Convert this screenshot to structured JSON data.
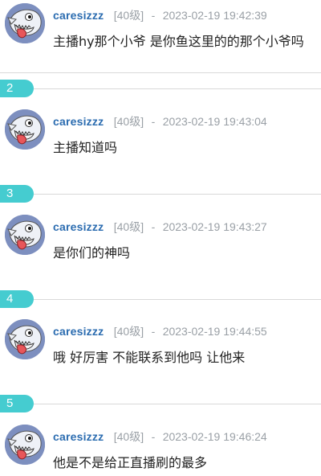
{
  "comments": [
    {
      "username": "caresizzz",
      "level": "[40级]",
      "separator": "-",
      "timestamp": "2023-02-19 19:42:39",
      "text": "主播hy那个小爷 是你鱼这里的的那个小爷吗"
    },
    {
      "floor": "2",
      "username": "caresizzz",
      "level": "[40级]",
      "separator": "-",
      "timestamp": "2023-02-19 19:43:04",
      "text": "主播知道吗"
    },
    {
      "floor": "3",
      "username": "caresizzz",
      "level": "[40级]",
      "separator": "-",
      "timestamp": "2023-02-19 19:43:27",
      "text": "是你们的神吗"
    },
    {
      "floor": "4",
      "username": "caresizzz",
      "level": "[40级]",
      "separator": "-",
      "timestamp": "2023-02-19 19:44:55",
      "text": "哦 好厉害 不能联系到他吗 让他来"
    },
    {
      "floor": "5",
      "username": "caresizzz",
      "level": "[40级]",
      "separator": "-",
      "timestamp": "2023-02-19 19:46:24",
      "text": "他是不是给正直播刷的最多"
    }
  ],
  "avatar_icon": "shark-avatar-icon",
  "colors": {
    "username": "#2b6cb0",
    "meta": "#9aa0a6",
    "badge": "#45ccd0",
    "divider": "#d9d9d9",
    "text": "#222222"
  }
}
